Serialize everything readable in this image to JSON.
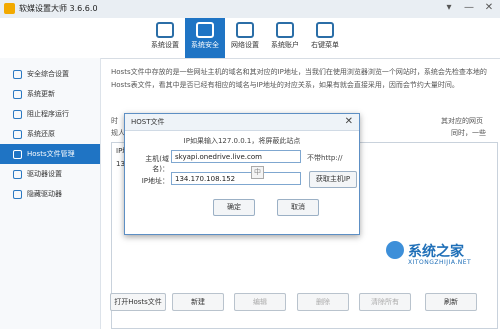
{
  "window": {
    "title": "软媒设置大师 3.6.6.0",
    "controls": [
      "▾",
      "—",
      "✕"
    ]
  },
  "toolbar": {
    "items": [
      {
        "label": "系统设置",
        "active": false
      },
      {
        "label": "系统安全",
        "active": true
      },
      {
        "label": "网络设置",
        "active": false
      },
      {
        "label": "系统账户",
        "active": false
      },
      {
        "label": "右键菜单",
        "active": false
      }
    ]
  },
  "sidebar": {
    "items": [
      {
        "label": "安全综合设置",
        "active": false
      },
      {
        "label": "系统更新",
        "active": false
      },
      {
        "label": "阻止程序运行",
        "active": false
      },
      {
        "label": "系统还原",
        "active": false
      },
      {
        "label": "Hosts文件管理",
        "active": true
      },
      {
        "label": "驱动器设置",
        "active": false
      },
      {
        "label": "隐藏驱动器",
        "active": false
      }
    ]
  },
  "content": {
    "description": "Hosts文件中存放的是一些网址主机的域名和其对应的IP地址，当我们在使用浏览器浏览一个网站时，系统会先检查本地的Hosts表文件，看其中是否已经有相应的域名与IP地址的对应关系，如果有就会直接采用，因而会节约大量时间。",
    "fragments": {
      "left_1": "时",
      "left_2": "规人",
      "right_1": "其对应的网页",
      "right_2": "同时，一些"
    },
    "panel_header": "IP地",
    "panel_row": "134"
  },
  "bottom_buttons": [
    {
      "label": "打开Hosts文件",
      "enabled": true
    },
    {
      "label": "新建",
      "enabled": true
    },
    {
      "label": "编辑",
      "enabled": false
    },
    {
      "label": "删除",
      "enabled": false
    },
    {
      "label": "清除所有",
      "enabled": false
    },
    {
      "label": "刷新",
      "enabled": true
    }
  ],
  "dialog": {
    "title": "HOST文件",
    "close_glyph": "✕",
    "note": "IP如果输入127.0.0.1，将屏蔽此站点",
    "host_label": "主机(域名)：",
    "host_value": "skyapi.onedrive.live.com",
    "host_hint": "不带http://",
    "ip_label": "IP地址：",
    "ip_value": "134.170.108.152",
    "get_ip_label": "获取主机IP",
    "ok_label": "确定",
    "cancel_label": "取消",
    "ime_glyph": "中"
  },
  "watermark": {
    "brand": "系统之家",
    "url": "XITONGZHIJIA.NET"
  },
  "colors": {
    "accent": "#1f74c4",
    "sidebar_bg": "#f7f9fb",
    "dialog_border": "#5d8fc4"
  }
}
